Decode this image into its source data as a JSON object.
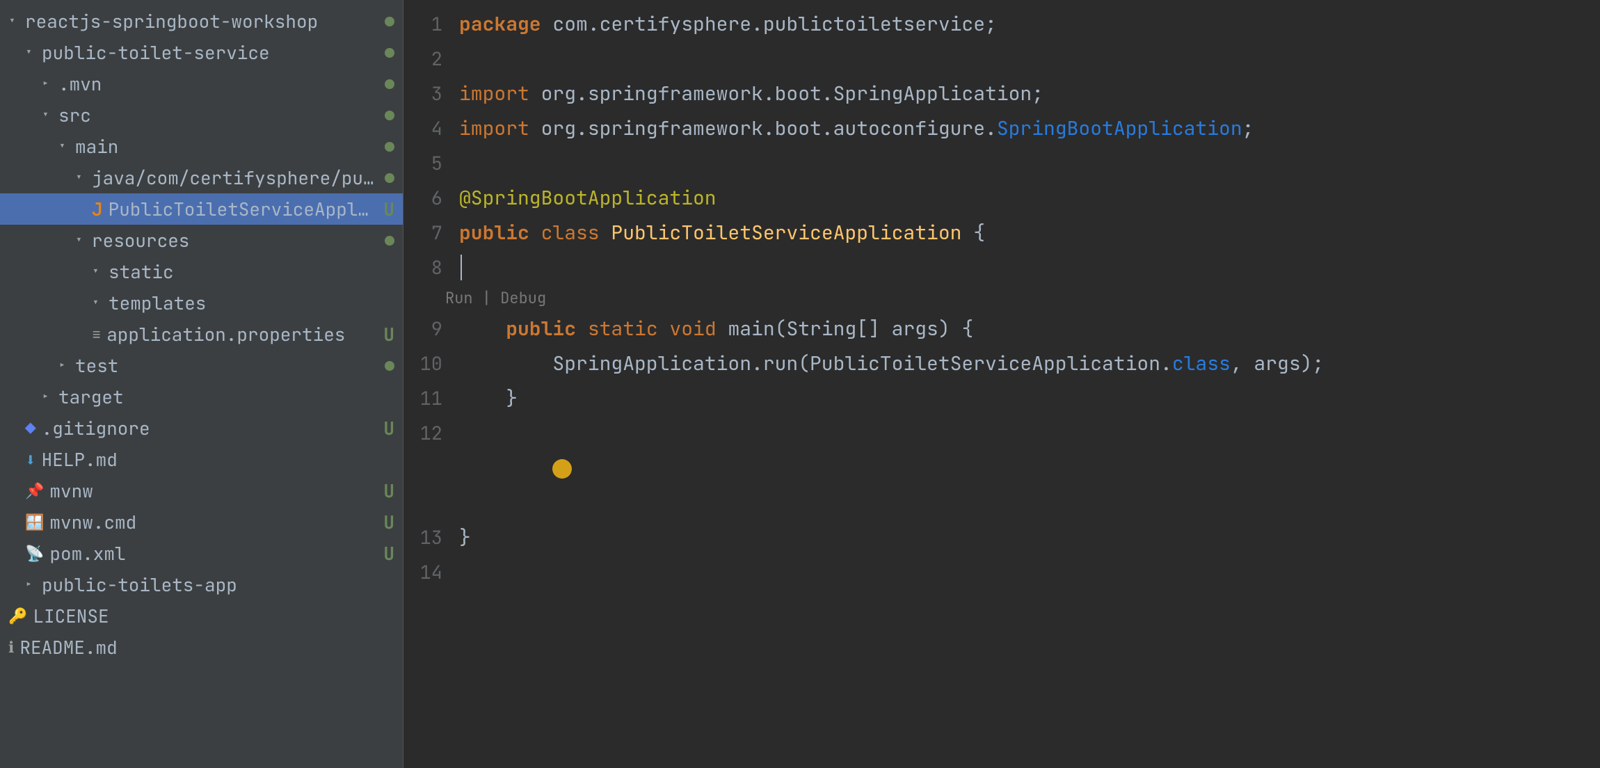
{
  "sidebar": {
    "items": [
      {
        "id": "reactjs-workshop",
        "label": "reactjs-springboot-workshop",
        "indent": 0,
        "type": "folder-open",
        "dot": true
      },
      {
        "id": "public-toilet-service",
        "label": "public-toilet-service",
        "indent": 1,
        "type": "folder-open",
        "dot": true
      },
      {
        "id": "mvn",
        "label": ".mvn",
        "indent": 2,
        "type": "folder-closed",
        "dot": true
      },
      {
        "id": "src",
        "label": "src",
        "indent": 2,
        "type": "folder-open",
        "dot": true
      },
      {
        "id": "main",
        "label": "main",
        "indent": 3,
        "type": "folder-open",
        "dot": true
      },
      {
        "id": "java-path",
        "label": "java/com/certifysphere/publictoiletservi...",
        "indent": 4,
        "type": "folder-open",
        "dot": true
      },
      {
        "id": "PublicToiletServiceApplication",
        "label": "PublicToiletServiceApplication.java",
        "indent": 5,
        "type": "java",
        "badge": "U",
        "selected": true
      },
      {
        "id": "resources",
        "label": "resources",
        "indent": 4,
        "type": "folder-open",
        "dot": true
      },
      {
        "id": "static",
        "label": "static",
        "indent": 5,
        "type": "folder-closed"
      },
      {
        "id": "templates",
        "label": "templates",
        "indent": 5,
        "type": "folder-closed"
      },
      {
        "id": "application-properties",
        "label": "application.properties",
        "indent": 5,
        "type": "properties",
        "badge": "U"
      },
      {
        "id": "test",
        "label": "test",
        "indent": 3,
        "type": "folder-closed",
        "dot": true
      },
      {
        "id": "target",
        "label": "target",
        "indent": 2,
        "type": "folder-closed"
      },
      {
        "id": "gitignore",
        "label": ".gitignore",
        "indent": 1,
        "type": "gitignore",
        "badge": "U"
      },
      {
        "id": "helpmd",
        "label": "HELP.md",
        "indent": 1,
        "type": "helpmd"
      },
      {
        "id": "mvnw",
        "label": "mvnw",
        "indent": 1,
        "type": "mvnw",
        "badge": "U"
      },
      {
        "id": "mvnwcmd",
        "label": "mvnw.cmd",
        "indent": 1,
        "type": "mvnwcmd",
        "badge": "U"
      },
      {
        "id": "pomxml",
        "label": "pom.xml",
        "indent": 1,
        "type": "pomxml",
        "badge": "U"
      },
      {
        "id": "public-toilets-app",
        "label": "public-toilets-app",
        "indent": 1,
        "type": "folder-closed"
      },
      {
        "id": "LICENSE",
        "label": "LICENSE",
        "indent": 0,
        "type": "license"
      },
      {
        "id": "READMEmd",
        "label": "README.md",
        "indent": 0,
        "type": "readme"
      }
    ]
  },
  "editor": {
    "filename": "PublicToiletServiceApplication.java",
    "lines": [
      {
        "num": 1,
        "tokens": [
          {
            "t": "package-kw",
            "v": "package "
          },
          {
            "t": "plain",
            "v": "com.certifysphere.publictoiletservice;"
          }
        ]
      },
      {
        "num": 2,
        "tokens": []
      },
      {
        "num": 3,
        "tokens": [
          {
            "t": "import-kw",
            "v": "import "
          },
          {
            "t": "plain",
            "v": "org.springframework.boot.SpringApplication;"
          }
        ]
      },
      {
        "num": 4,
        "tokens": [
          {
            "t": "import-kw",
            "v": "import "
          },
          {
            "t": "plain",
            "v": "org.springframework.boot.autoconfigure."
          },
          {
            "t": "link",
            "v": "SpringBootApplication"
          },
          {
            "t": "plain",
            "v": ";"
          }
        ]
      },
      {
        "num": 5,
        "tokens": []
      },
      {
        "num": 6,
        "tokens": [
          {
            "t": "annotation",
            "v": "@SpringBootApplication"
          }
        ]
      },
      {
        "num": 7,
        "tokens": [
          {
            "t": "kw",
            "v": "public "
          },
          {
            "t": "kw2",
            "v": "class "
          },
          {
            "t": "class-name",
            "v": "PublicToiletServiceApplication "
          },
          {
            "t": "plain",
            "v": "{"
          }
        ]
      },
      {
        "num": 8,
        "tokens": [],
        "has_run_debug": true
      },
      {
        "num": 9,
        "tokens": [
          {
            "t": "kw",
            "v": "    public "
          },
          {
            "t": "kw2",
            "v": "static "
          },
          {
            "t": "kw2",
            "v": "void "
          },
          {
            "t": "plain",
            "v": "main(String[] args) {"
          }
        ]
      },
      {
        "num": 10,
        "tokens": [
          {
            "t": "plain",
            "v": "        SpringApplication.run(PublicToiletServiceApplication."
          },
          {
            "t": "link",
            "v": "class"
          },
          {
            "t": "plain",
            "v": ", args);"
          }
        ]
      },
      {
        "num": 11,
        "tokens": [
          {
            "t": "plain",
            "v": "    }"
          }
        ]
      },
      {
        "num": 12,
        "tokens": [],
        "has_bulb": true
      },
      {
        "num": 13,
        "tokens": [
          {
            "t": "plain",
            "v": "}"
          }
        ]
      },
      {
        "num": 14,
        "tokens": []
      }
    ],
    "run_debug_label": "Run | Debug"
  },
  "icons": {
    "folder_open": "▾",
    "folder_closed": "▸",
    "java_letter": "J",
    "dot_indicator": "●",
    "gitignore_sym": "◆",
    "help_icon": "⬇",
    "mvnw_icon": "📌",
    "mvnwcmd_icon": "🪟",
    "pom_icon": "📡",
    "license_sym": "🔑",
    "readme_sym": "ℹ",
    "properties_sym": "≡"
  },
  "colors": {
    "selected_bg": "#4b6eaf",
    "sidebar_bg": "#3c3f41",
    "editor_bg": "#2b2b2b",
    "dot_color": "#6a8759",
    "badge_color": "#6a8759"
  }
}
